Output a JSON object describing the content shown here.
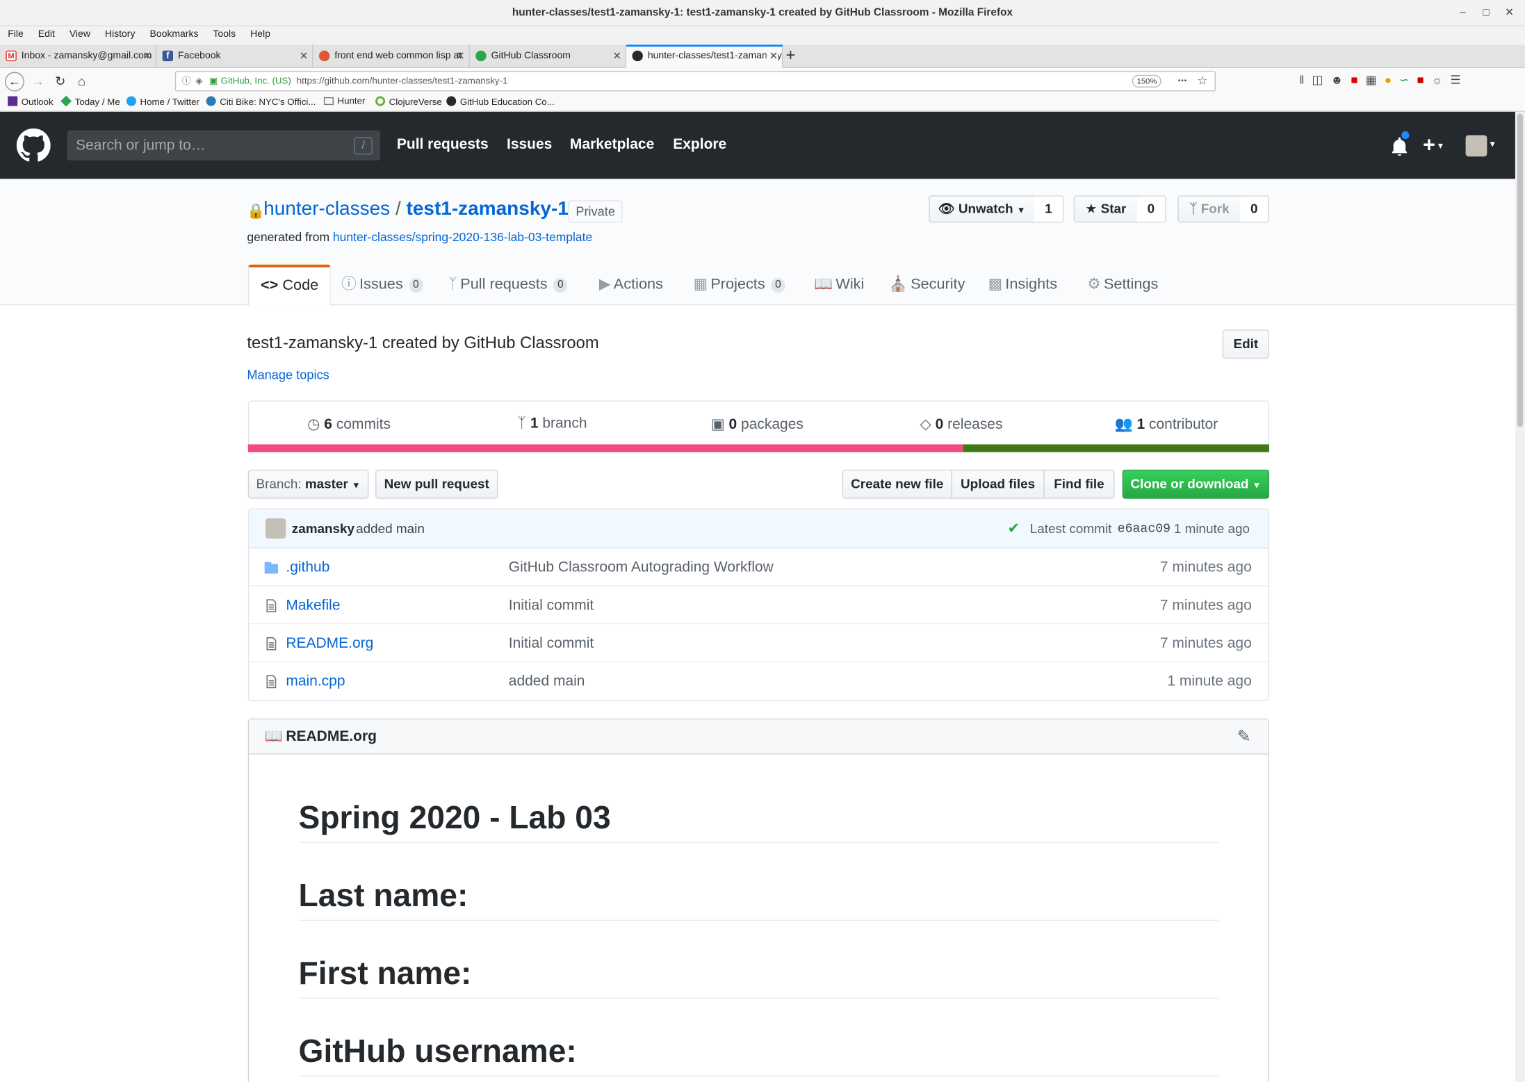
{
  "window": {
    "title": "hunter-classes/test1-zamansky-1: test1-zamansky-1 created by GitHub Classroom - Mozilla Firefox"
  },
  "menubar": [
    "File",
    "Edit",
    "View",
    "History",
    "Bookmarks",
    "Tools",
    "Help"
  ],
  "tabs": [
    {
      "label": "Inbox - zamansky@gmail.com",
      "color": "#d93025"
    },
    {
      "label": "Facebook",
      "color": "#3b5998"
    },
    {
      "label": "front end web common lisp at",
      "color": "#de5833"
    },
    {
      "label": "GitHub Classroom",
      "color": "#24292e"
    },
    {
      "label": "hunter-classes/test1-zamansky-1",
      "color": "#24292e"
    }
  ],
  "navbar": {
    "site_identity": "GitHub, Inc. (US)",
    "url": "https://github.com/hunter-classes/test1-zamansky-1",
    "zoom": "150%"
  },
  "bookmarks": [
    {
      "label": "Outlook",
      "icon": "outlook-icon",
      "color": "#5b2d90"
    },
    {
      "label": "Today / Me",
      "icon": "diamond-icon",
      "color": "#2ea44f"
    },
    {
      "label": "Home / Twitter",
      "icon": "twitter-icon",
      "color": "#1da1f2"
    },
    {
      "label": "Citi Bike: NYC's Offici...",
      "icon": "bike-icon",
      "color": "#2b7bb9"
    },
    {
      "label": "Hunter",
      "icon": "folder-icon",
      "color": "#777777"
    },
    {
      "label": "ClojureVerse",
      "icon": "clojure-icon",
      "color": "#63b132"
    },
    {
      "label": "GitHub Education Co...",
      "icon": "github-icon",
      "color": "#24292e"
    }
  ],
  "header": {
    "search_placeholder": "Search or jump to…",
    "search_key": "/",
    "nav": [
      "Pull requests",
      "Issues",
      "Marketplace",
      "Explore"
    ]
  },
  "repo": {
    "owner": "hunter-classes",
    "separator": "/",
    "name": "test1-zamansky-1",
    "visibility": "Private",
    "generated_prefix": "generated from",
    "template": "hunter-classes/spring-2020-136-lab-03-template",
    "unwatch_label": "Unwatch",
    "watch_count": "1",
    "star_label": "Star",
    "star_count": "0",
    "fork_label": "Fork",
    "fork_count": "0",
    "description": "test1-zamansky-1 created by GitHub Classroom",
    "edit_label": "Edit",
    "manage_topics": "Manage topics"
  },
  "repo_tabs": [
    {
      "label": "Code",
      "count": null
    },
    {
      "label": "Issues",
      "count": "0"
    },
    {
      "label": "Pull requests",
      "count": "0"
    },
    {
      "label": "Actions",
      "count": null
    },
    {
      "label": "Projects",
      "count": "0"
    },
    {
      "label": "Wiki",
      "count": null
    },
    {
      "label": "Security",
      "count": null
    },
    {
      "label": "Insights",
      "count": null
    },
    {
      "label": "Settings",
      "count": null
    }
  ],
  "summary": {
    "commits_count": "6",
    "commits_label": "commits",
    "branch_count": "1",
    "branch_label": "branch",
    "packages_count": "0",
    "packages_label": "packages",
    "releases_count": "0",
    "releases_label": "releases",
    "contributors_count": "1",
    "contributors_label": "contributor"
  },
  "languages": [
    {
      "share": 0.7,
      "color": "#f34b7d"
    },
    {
      "share": 0.3,
      "color": "#427819"
    }
  ],
  "toolbar": {
    "branch_prefix": "Branch:",
    "branch": "master",
    "new_pr": "New pull request",
    "create_file": "Create new file",
    "upload": "Upload files",
    "find": "Find file",
    "clone": "Clone or download"
  },
  "latest_commit": {
    "author": "zamansky",
    "message": "added main",
    "prefix": "Latest commit",
    "sha": "e6aac09",
    "age": "1 minute ago"
  },
  "files": [
    {
      "name": ".github",
      "type": "dir",
      "message": "GitHub Classroom Autograding Workflow",
      "age": "7 minutes ago"
    },
    {
      "name": "Makefile",
      "type": "file",
      "message": "Initial commit",
      "age": "7 minutes ago"
    },
    {
      "name": "README.org",
      "type": "file",
      "message": "Initial commit",
      "age": "7 minutes ago"
    },
    {
      "name": "main.cpp",
      "type": "file",
      "message": "added main",
      "age": "1 minute ago"
    }
  ],
  "readme": {
    "filename": "README.org",
    "headings": [
      "Spring 2020 - Lab 03",
      "Last name:",
      "First name:",
      "GitHub username:"
    ]
  }
}
